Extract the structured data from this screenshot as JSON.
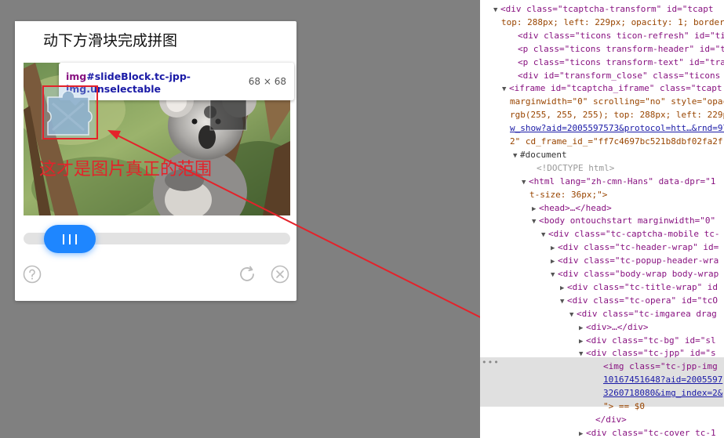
{
  "captcha": {
    "title": "动下方滑块完成拼图",
    "annotation": "这才是图片真正的范围",
    "tooltip": {
      "tag": "img",
      "selector": "#slideBlock.tc-jpp-img.unselectable",
      "size": "68 × 68"
    },
    "icons": {
      "help": "help-circle-icon",
      "refresh": "refresh-icon",
      "close": "close-circle-icon"
    },
    "colors": {
      "accent": "#1e86ff",
      "annotation": "#e4222a"
    }
  },
  "devtools": {
    "lines": [
      {
        "indent": 27,
        "tw": "▼",
        "text": "<div class=\"tcaptcha-transform\" id=\"tcapt"
      },
      {
        "indent": 27,
        "tw": "",
        "text": "top: 288px; left: 229px; opacity: 1; border"
      },
      {
        "indent": 48,
        "tw": "",
        "text": "<div class=\"ticons ticon-refresh\" id=\"ti"
      },
      {
        "indent": 48,
        "tw": "",
        "text": "<p class=\"ticons transform-header\" id=\"t"
      },
      {
        "indent": 48,
        "tw": "",
        "text": "<p class=\"ticons transform-text\" id=\"tra"
      },
      {
        "indent": 48,
        "tw": "",
        "text": "<div id=\"transform_close\" class=\"ticons"
      },
      {
        "indent": 38,
        "tw": "▼",
        "text": "<iframe id=\"tcaptcha_iframe\" class=\"tcapt"
      },
      {
        "indent": 38,
        "tw": "",
        "text": "marginwidth=\"0\" scrolling=\"no\" style=\"opac"
      },
      {
        "indent": 38,
        "tw": "",
        "text": "rgb(255, 255, 255); top: 288px; left: 229p"
      },
      {
        "indent": 38,
        "tw": "",
        "text": "w_show?aid=2005597573&protocol=htt…&rnd=97"
      },
      {
        "indent": 38,
        "tw": "",
        "text": "2\" cd_frame_id_=\"ff7c4697bc521b8dbf02fa2f"
      },
      {
        "indent": 52,
        "tw": "▼",
        "text": "#document"
      },
      {
        "indent": 72,
        "tw": "",
        "text": "<!DOCTYPE html>"
      },
      {
        "indent": 63,
        "tw": "▼",
        "text": "<html lang=\"zh-cmn-Hans\" data-dpr=\"1"
      },
      {
        "indent": 63,
        "tw": "",
        "text": "t-size: 36px;\">"
      },
      {
        "indent": 76,
        "tw": "▶",
        "text": "<head>…</head>"
      },
      {
        "indent": 76,
        "tw": "▼",
        "text": "<body ontouchstart marginwidth=\"0\""
      },
      {
        "indent": 88,
        "tw": "▼",
        "text": "<div class=\"tc-captcha-mobile tc-"
      },
      {
        "indent": 100,
        "tw": "▶",
        "text": "<div class=\"tc-header-wrap\" id="
      },
      {
        "indent": 100,
        "tw": "▶",
        "text": "<div class=\"tc-popup-header-wra"
      },
      {
        "indent": 100,
        "tw": "▼",
        "text": "<div class=\"body-wrap body-wrap"
      },
      {
        "indent": 112,
        "tw": "▶",
        "text": "<div class=\"tc-title-wrap\" id"
      },
      {
        "indent": 112,
        "tw": "▼",
        "text": "<div class=\"tc-opera\" id=\"tcO"
      },
      {
        "indent": 124,
        "tw": "▼",
        "text": "<div class=\"tc-imgarea drag"
      },
      {
        "indent": 136,
        "tw": "▶",
        "text": "<div>…</div>"
      },
      {
        "indent": 136,
        "tw": "▶",
        "text": "<div class=\"tc-bg\" id=\"sl"
      },
      {
        "indent": 136,
        "tw": "▼",
        "text": "<div class=\"tc-jpp\" id=\"s"
      },
      {
        "indent": 157,
        "tw": "",
        "text": "<img class=\"tc-jpp-img"
      },
      {
        "indent": 157,
        "tw": "",
        "text": "10167451648?aid=2005597"
      },
      {
        "indent": 157,
        "tw": "",
        "text": "3260718080&img_index=2&"
      },
      {
        "indent": 157,
        "tw": "",
        "text": "\"> == $0"
      },
      {
        "indent": 147,
        "tw": "",
        "text": "</div>"
      },
      {
        "indent": 136,
        "tw": "▶",
        "text": "<div class=\"tc-cover tc-1"
      }
    ]
  }
}
